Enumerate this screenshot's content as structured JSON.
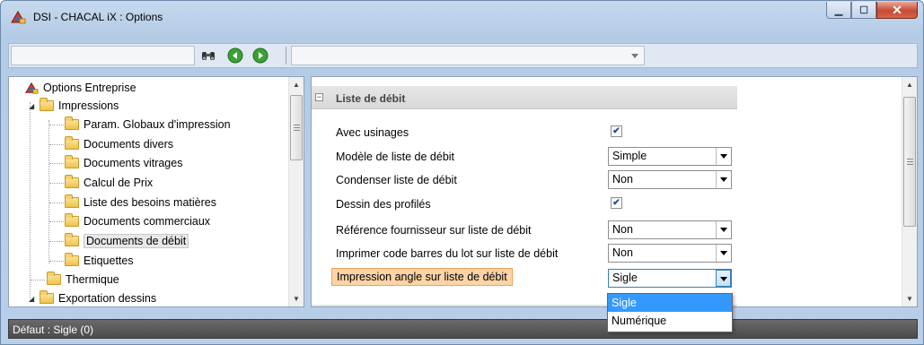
{
  "window": {
    "title": "DSI - CHACAL iX : Options"
  },
  "toolbar": {
    "search_value": "",
    "combo_value": ""
  },
  "tree": {
    "root": "Options Entreprise",
    "items": [
      {
        "label": "Impressions"
      },
      {
        "label": "Param. Globaux d'impression"
      },
      {
        "label": "Documents divers"
      },
      {
        "label": "Documents vitrages"
      },
      {
        "label": "Calcul de Prix"
      },
      {
        "label": "Liste des besoins matières"
      },
      {
        "label": "Documents commerciaux"
      },
      {
        "label": "Documents de débit"
      },
      {
        "label": "Etiquettes"
      },
      {
        "label": "Thermique"
      },
      {
        "label": "Exportation dessins"
      }
    ]
  },
  "properties": {
    "section_title": "Liste de débit",
    "rows": [
      {
        "label": "Avec usinages",
        "check": "✔"
      },
      {
        "label": "Modèle de liste de débit",
        "value": "Simple"
      },
      {
        "label": "Condenser liste de débit",
        "value": "Non"
      },
      {
        "label": "Dessin des profilés",
        "check": "✔"
      },
      {
        "label": "Référence fournisseur sur liste de débit",
        "value": "Non"
      },
      {
        "label": "Imprimer code barres du lot sur liste de débit",
        "value": "Non"
      },
      {
        "label": "Impression angle sur liste de débit",
        "value": "Sigle"
      }
    ]
  },
  "dropdown": {
    "options": [
      "Sigle",
      "Numérique"
    ],
    "selected_index": 0
  },
  "status": {
    "text": "Défaut : Sigle (0)"
  },
  "colors": {
    "highlight": "#fdd4a6",
    "selection": "#3399ff"
  }
}
